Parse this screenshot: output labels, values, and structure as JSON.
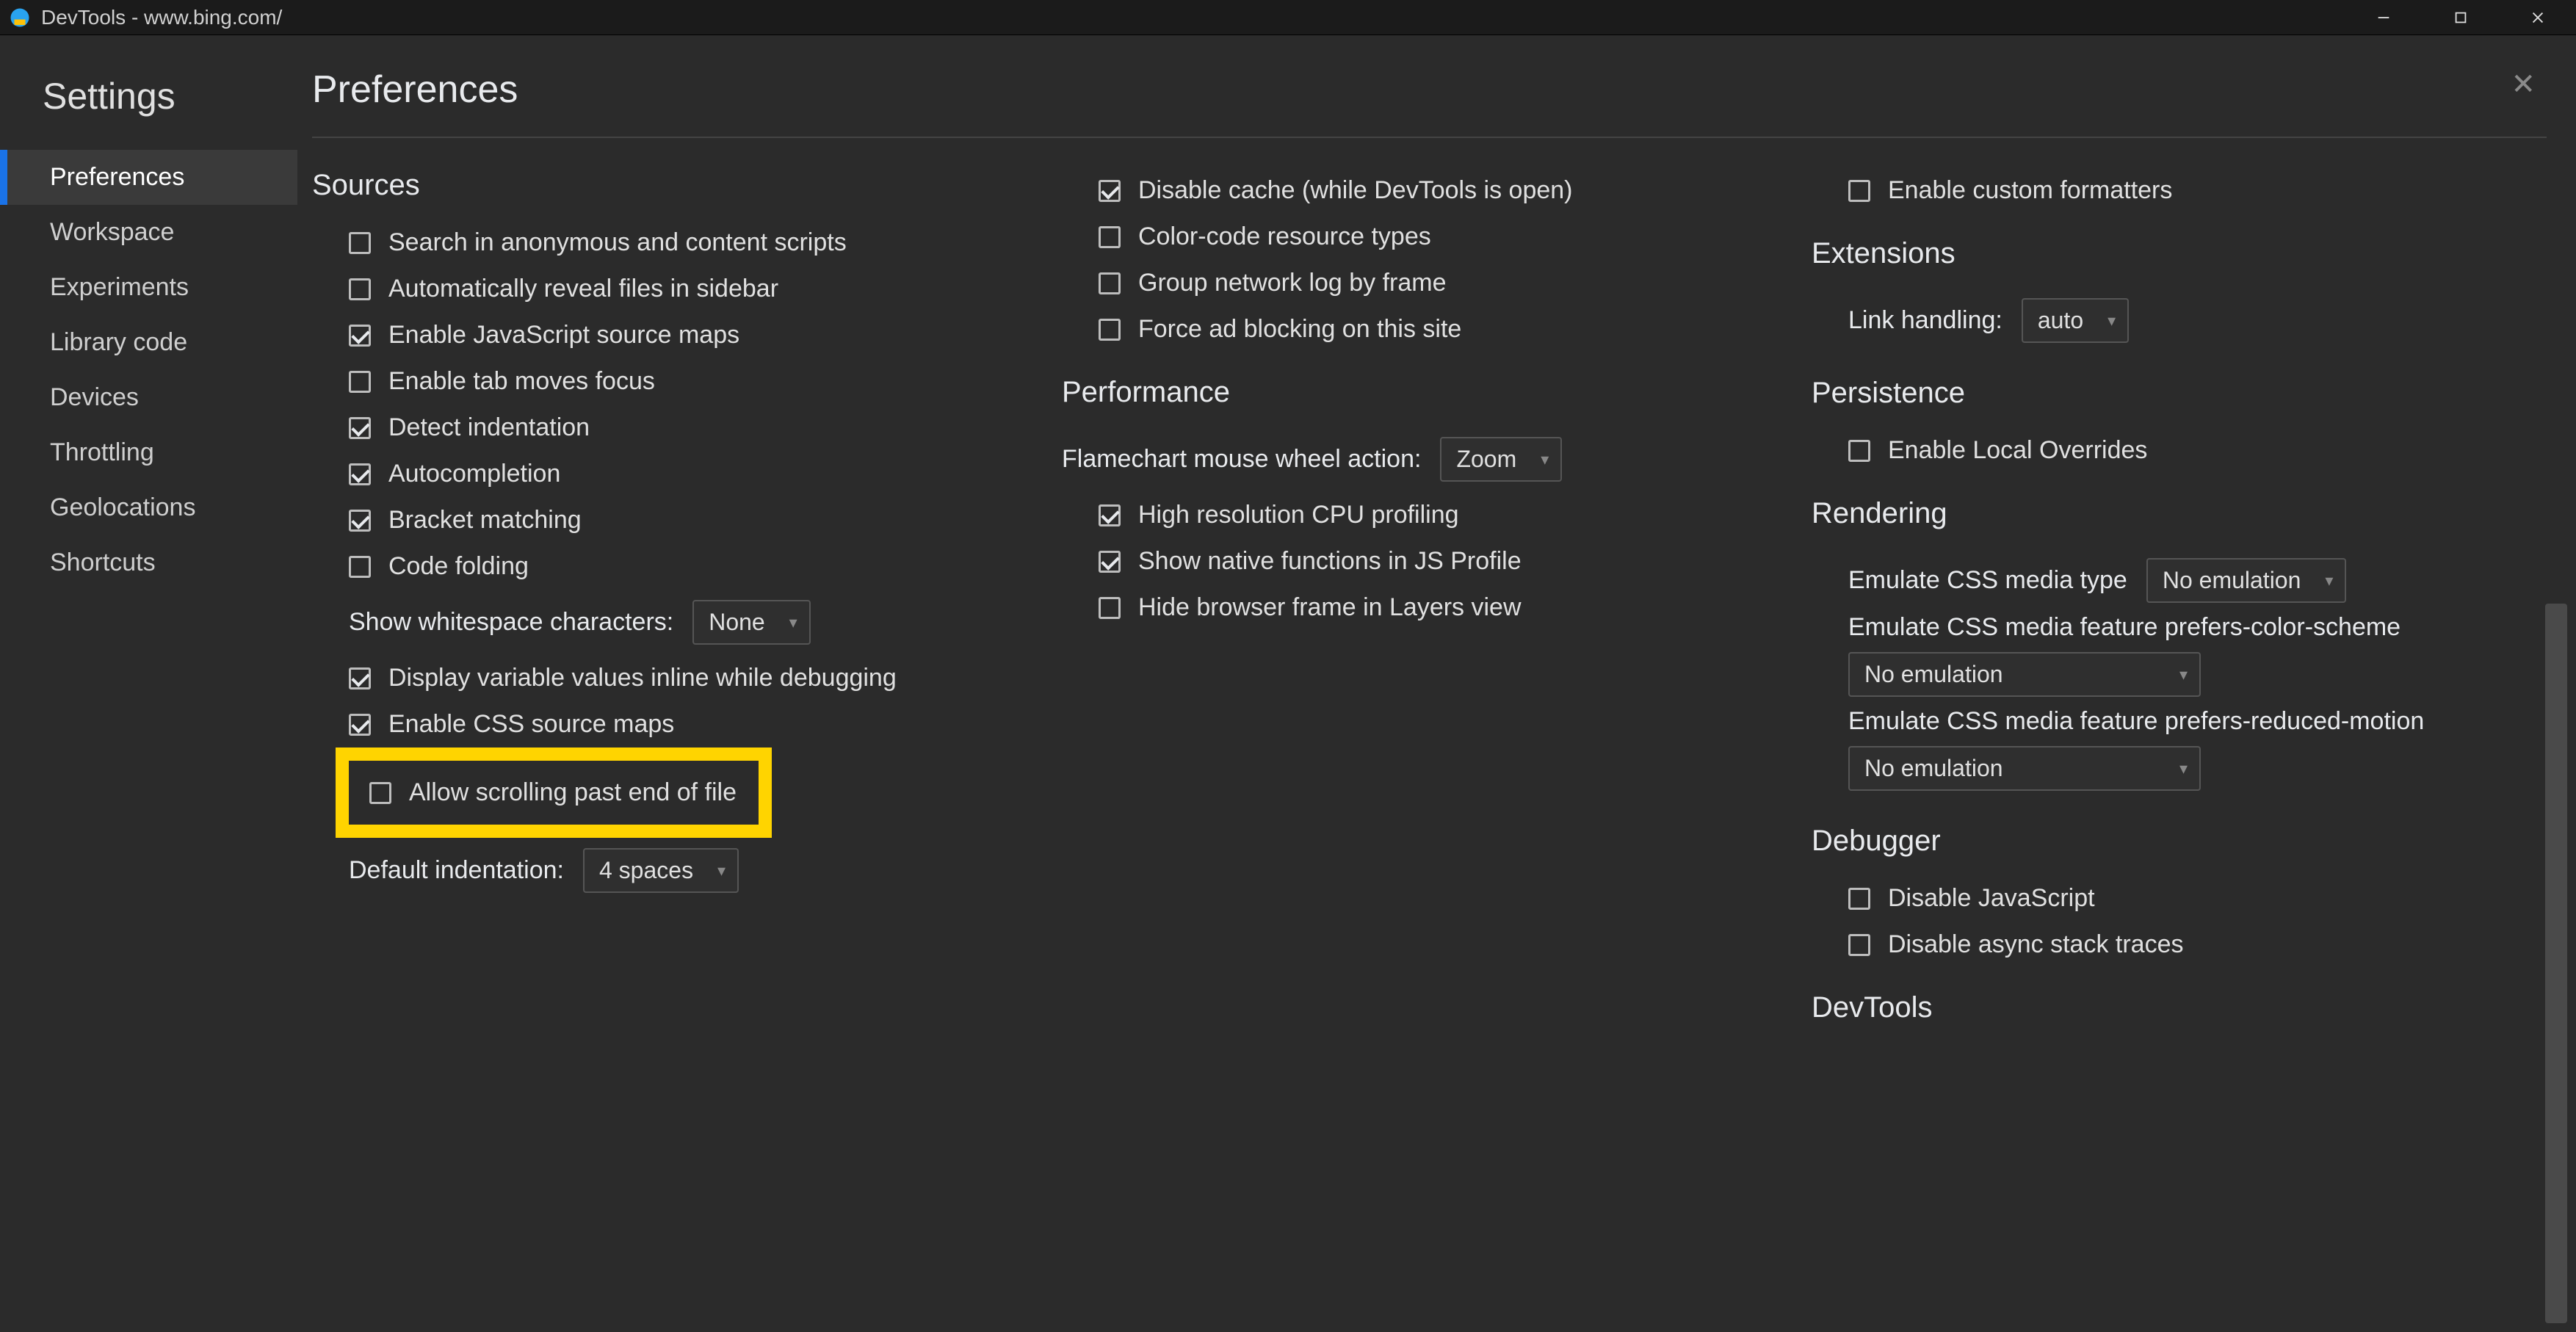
{
  "titlebar": {
    "title": "DevTools - www.bing.com/"
  },
  "sidebar": {
    "heading": "Settings",
    "items": [
      {
        "label": "Preferences",
        "active": true
      },
      {
        "label": "Workspace"
      },
      {
        "label": "Experiments"
      },
      {
        "label": "Library code"
      },
      {
        "label": "Devices"
      },
      {
        "label": "Throttling"
      },
      {
        "label": "Geolocations"
      },
      {
        "label": "Shortcuts"
      }
    ]
  },
  "main": {
    "heading": "Preferences",
    "col1": {
      "section_sources": "Sources",
      "opt_search_anon": "Search in anonymous and content scripts",
      "opt_auto_reveal": "Automatically reveal files in sidebar",
      "opt_js_maps": "Enable JavaScript source maps",
      "opt_tab_focus": "Enable tab moves focus",
      "opt_detect_indent": "Detect indentation",
      "opt_autocomplete": "Autocompletion",
      "opt_bracket": "Bracket matching",
      "opt_folding": "Code folding",
      "lbl_whitespace": "Show whitespace characters:",
      "sel_whitespace": "None",
      "opt_display_inline": "Display variable values inline while debugging",
      "opt_css_maps": "Enable CSS source maps",
      "opt_scroll_past": "Allow scrolling past end of file",
      "lbl_default_indent": "Default indentation:",
      "sel_default_indent": "4 spaces"
    },
    "col2": {
      "opt_disable_cache": "Disable cache (while DevTools is open)",
      "opt_color_code": "Color-code resource types",
      "opt_group_frame": "Group network log by frame",
      "opt_force_ad": "Force ad blocking on this site",
      "section_perf": "Performance",
      "lbl_flamechart": "Flamechart mouse wheel action:",
      "sel_flamechart": "Zoom",
      "opt_high_res": "High resolution CPU profiling",
      "opt_native_fn": "Show native functions in JS Profile",
      "opt_hide_frame": "Hide browser frame in Layers view"
    },
    "col3": {
      "opt_custom_fmt": "Enable custom formatters",
      "section_ext": "Extensions",
      "lbl_link": "Link handling:",
      "sel_link": "auto",
      "section_persist": "Persistence",
      "opt_local_override": "Enable Local Overrides",
      "section_render": "Rendering",
      "lbl_css_media": "Emulate CSS media type",
      "sel_css_media": "No emulation",
      "lbl_css_color": "Emulate CSS media feature prefers-color-scheme",
      "sel_css_color": "No emulation",
      "lbl_css_motion": "Emulate CSS media feature prefers-reduced-motion",
      "sel_css_motion": "No emulation",
      "section_debugger": "Debugger",
      "opt_disable_js": "Disable JavaScript",
      "opt_disable_async": "Disable async stack traces",
      "section_devtools": "DevTools"
    }
  }
}
